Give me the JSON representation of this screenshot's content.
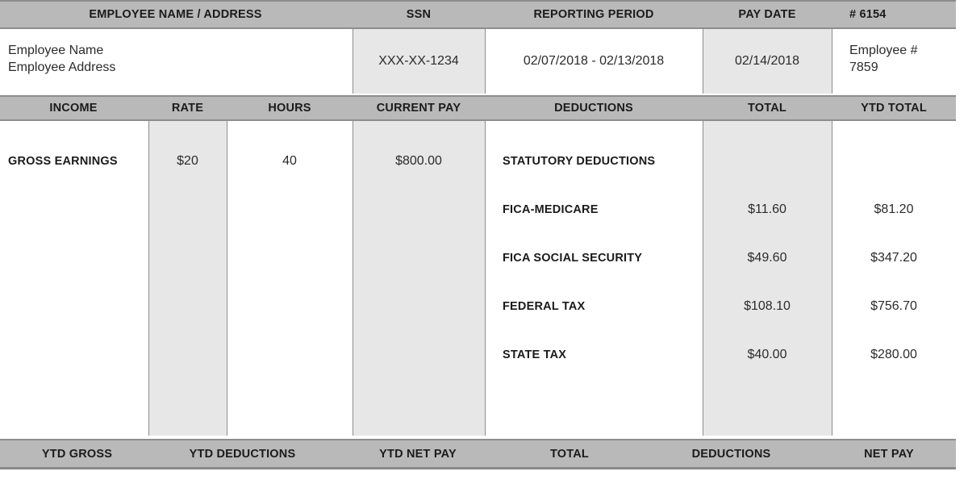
{
  "document": {
    "type": "pay-stub",
    "check_number_label": "# 6154"
  },
  "colors": {
    "header_band": "#b9b9b9",
    "cell_shade": "#e7e7e7",
    "border": "#8d8d8d",
    "text": "#1b1b1b",
    "page_background": "#ffffff"
  },
  "top_header": {
    "employee_name_address": "EMPLOYEE NAME / ADDRESS",
    "ssn": "SSN",
    "reporting_period": "REPORTING PERIOD",
    "pay_date": "PAY DATE",
    "check_number": "# 6154"
  },
  "top_values": {
    "employee_name": "Employee Name",
    "employee_address": "Employee Address",
    "ssn": "XXX-XX-1234",
    "reporting_period": "02/07/2018 - 02/13/2018",
    "pay_date": "02/14/2018",
    "employee_id_label": "Employee #",
    "employee_id_value": "7859"
  },
  "column_header": {
    "income": "INCOME",
    "rate": "RATE",
    "hours": "HOURS",
    "current_pay": "CURRENT PAY",
    "deductions": "DEDUCTIONS",
    "total": "TOTAL",
    "ytd_total": "YTD TOTAL"
  },
  "earnings": {
    "rows": [
      {
        "income": "GROSS EARNINGS",
        "rate": "$20",
        "hours": "40",
        "current_pay": "$800.00"
      }
    ]
  },
  "deductions": {
    "rows": [
      {
        "label": "STATUTORY DEDUCTIONS",
        "total": "",
        "ytd_total": ""
      },
      {
        "label": "FICA-MEDICARE",
        "total": "$11.60",
        "ytd_total": "$81.20"
      },
      {
        "label": "FICA SOCIAL SECURITY",
        "total": "$49.60",
        "ytd_total": "$347.20"
      },
      {
        "label": "FEDERAL TAX",
        "total": "$108.10",
        "ytd_total": "$756.70"
      },
      {
        "label": "STATE TAX",
        "total": "$40.00",
        "ytd_total": "$280.00"
      }
    ]
  },
  "footer": {
    "ytd_gross": "YTD GROSS",
    "ytd_deductions": "YTD DEDUCTIONS",
    "ytd_net_pay": "YTD NET PAY",
    "total": "TOTAL",
    "deductions": "DEDUCTIONS",
    "net_pay": "NET PAY"
  }
}
